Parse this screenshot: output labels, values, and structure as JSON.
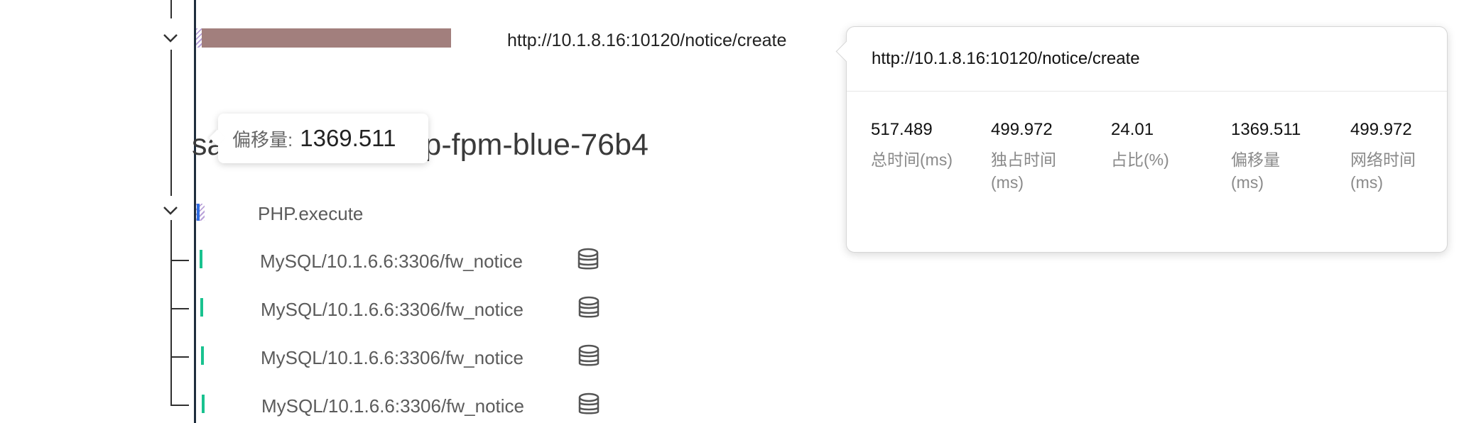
{
  "trace": {
    "root_url": "http://10.1.8.16:10120/notice/create",
    "service_text": "sa          m-blue-prd-php-fpm-blue-76b4",
    "php_label": "PHP.execute",
    "mysql_rows": [
      {
        "label": "MySQL/10.1.6.6:3306/fw_notice",
        "icon": "database-icon"
      },
      {
        "label": "MySQL/10.1.6.6:3306/fw_notice",
        "icon": "database-icon"
      },
      {
        "label": "MySQL/10.1.6.6:3306/fw_notice",
        "icon": "database-icon"
      },
      {
        "label": "MySQL/10.1.6.6:3306/fw_notice",
        "icon": "database-icon"
      }
    ]
  },
  "offset_tooltip": {
    "label": "偏移量:",
    "value": "1369.511"
  },
  "popover": {
    "title": "http://10.1.8.16:10120/notice/create",
    "metrics": [
      {
        "value": "517.489",
        "label": "总时间(ms)"
      },
      {
        "value": "499.972",
        "label": "独占时间(ms)"
      },
      {
        "value": "24.01",
        "label": "占比(%)"
      },
      {
        "value": "1369.511",
        "label": "偏移量(ms)"
      },
      {
        "value": "499.972",
        "label": "网络时间(ms)"
      }
    ]
  },
  "colors": {
    "root_bar": "#a27f7d",
    "php_bar": "#2f6de1",
    "mysql_bar": "#19c28f",
    "hatch": "#b9a2d9"
  }
}
